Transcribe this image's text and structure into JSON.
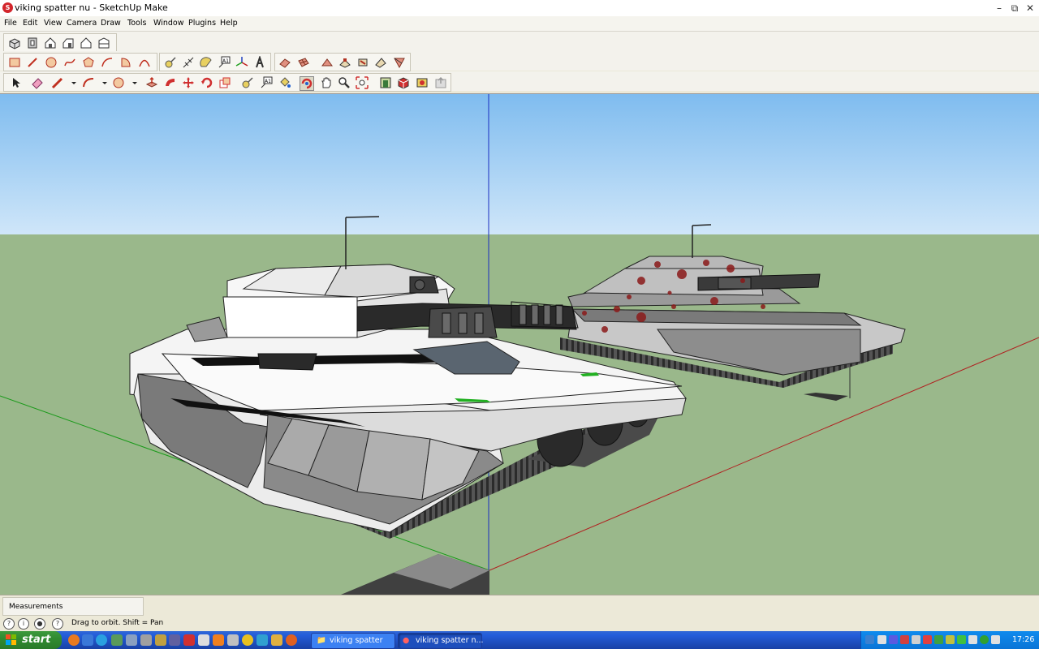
{
  "window": {
    "title": "viking spatter nu - SketchUp Make",
    "controls": {
      "minimize": "–",
      "restore": "⧉",
      "close": "✕"
    }
  },
  "menu": [
    "File",
    "Edit",
    "View",
    "Camera",
    "Draw",
    "Tools",
    "Window",
    "Plugins",
    "Help"
  ],
  "toolbars": {
    "views": [
      "iso-view-icon",
      "top-view-icon",
      "front-view-icon",
      "right-view-icon",
      "back-view-icon",
      "left-view-icon"
    ],
    "drawing": [
      "rectangle-icon",
      "line-icon",
      "circle-icon",
      "freehand-icon",
      "polygon-icon",
      "arc-icon",
      "pie-icon",
      "two-point-arc-icon"
    ],
    "construction": [
      "tape-measure-icon",
      "dimension-icon",
      "protractor-icon",
      "text-icon",
      "axes-icon",
      "3d-text-icon"
    ],
    "sandbox": [
      "sandbox-from-contours-icon",
      "sandbox-from-scratch-icon",
      "smoove-icon",
      "stamp-icon",
      "drape-icon",
      "add-detail-icon",
      "flip-edge-icon"
    ],
    "principal": [
      "select-icon",
      "eraser-icon",
      "pencil-icon",
      "arc-tool-icon",
      "shape-tool-icon",
      "push-pull-icon",
      "follow-me-icon",
      "move-icon",
      "rotate-icon",
      "scale-icon",
      "tape-icon",
      "text-label-icon",
      "paint-bucket-icon",
      "orbit-icon",
      "pan-icon",
      "zoom-icon",
      "zoom-extents-icon",
      "3d-warehouse-icon",
      "extension-warehouse-icon",
      "layout-icon",
      "share-model-icon"
    ]
  },
  "viewport": {
    "sky_color": "#a8d4f5",
    "ground_color": "#9ab88b",
    "models": [
      "white-tank-model",
      "blood-spatter-tank-model"
    ]
  },
  "measurements": {
    "label": "Measurements",
    "value": ""
  },
  "status": {
    "hint": "Drag to orbit.  Shift = Pan"
  },
  "taskbar": {
    "start_label": "start",
    "tasks": [
      {
        "label": "viking spatter",
        "active": false
      },
      {
        "label": "viking spatter n...",
        "active": true
      }
    ],
    "clock": "17:26"
  }
}
